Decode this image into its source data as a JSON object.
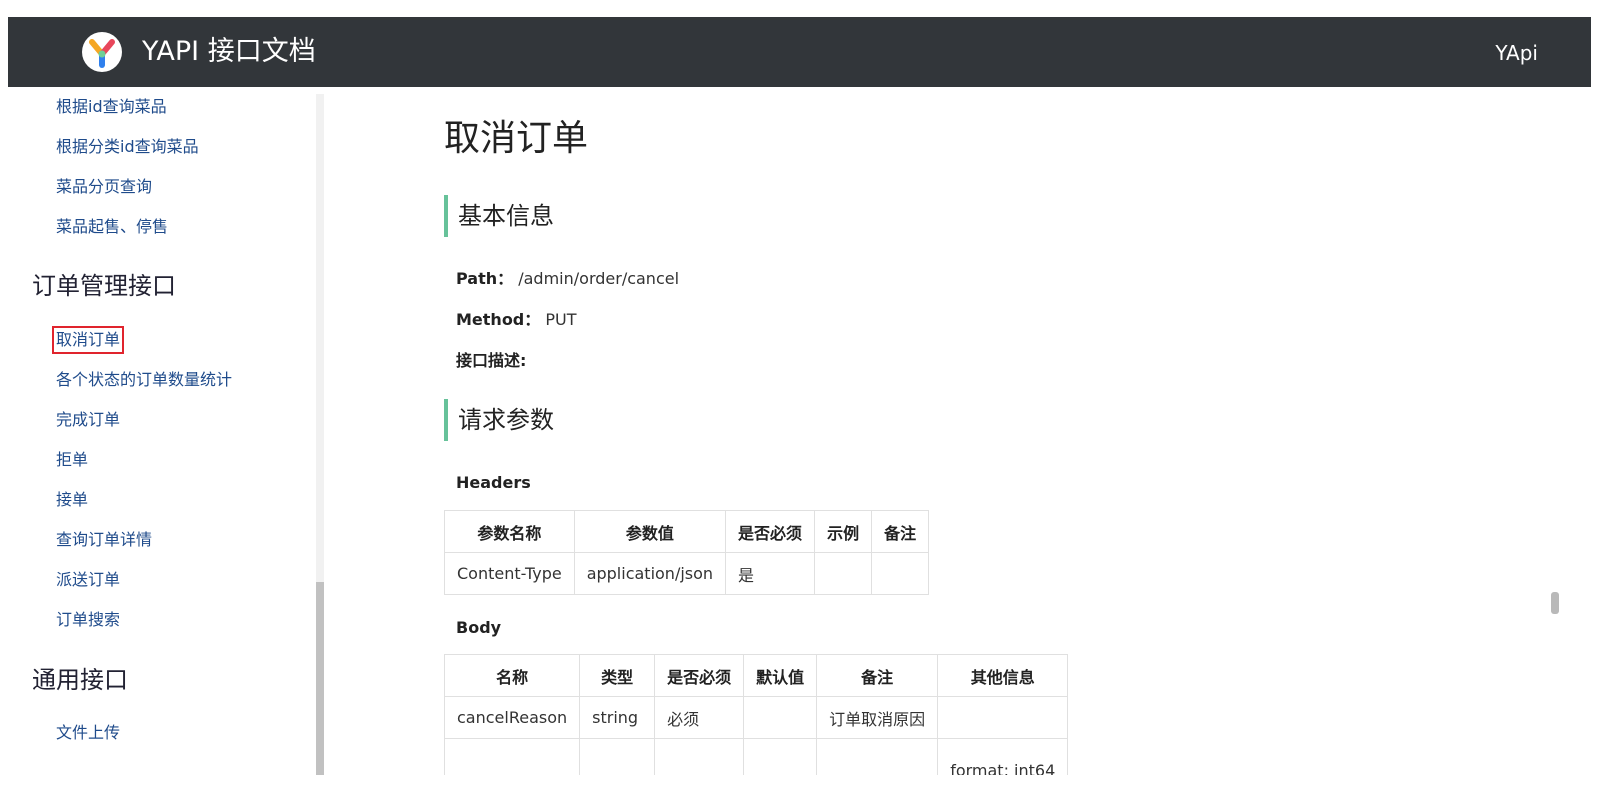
{
  "header": {
    "title": "YAPI 接口文档",
    "right_link": "YApi"
  },
  "sidebar": {
    "items_top": [
      "根据id查询菜品",
      "根据分类id查询菜品",
      "菜品分页查询",
      "菜品起售、停售"
    ],
    "group_order": "订单管理接口",
    "order_items": [
      "取消订单",
      "各个状态的订单数量统计",
      "完成订单",
      "拒单",
      "接单",
      "查询订单详情",
      "派送订单",
      "订单搜索"
    ],
    "group_common": "通用接口",
    "common_items": [
      "文件上传"
    ]
  },
  "main": {
    "title": "取消订单",
    "basic_info": "基本信息",
    "path_label": "Path：",
    "path_value": "/admin/order/cancel",
    "method_label": "Method：",
    "method_value": "PUT",
    "desc_label": "接口描述:",
    "request_params": "请求参数",
    "headers_label": "Headers",
    "headers_table": {
      "columns": [
        "参数名称",
        "参数值",
        "是否必须",
        "示例",
        "备注"
      ],
      "rows": [
        [
          "Content-Type",
          "application/json",
          "是",
          "",
          ""
        ]
      ]
    },
    "body_label": "Body",
    "body_table": {
      "columns": [
        "名称",
        "类型",
        "是否必须",
        "默认值",
        "备注",
        "其他信息"
      ],
      "rows": [
        [
          "cancelReason",
          "string",
          "必须",
          "",
          "订单取消原因",
          ""
        ],
        [
          "",
          "",
          "",
          "",
          "",
          "format: int64"
        ]
      ]
    }
  },
  "colors": {
    "header_bg": "#32363a",
    "accent": "#67c29a",
    "link": "#1f4b8b",
    "active_border": "#e0242d"
  },
  "icons": {
    "logo": "yapi-logo-icon"
  }
}
